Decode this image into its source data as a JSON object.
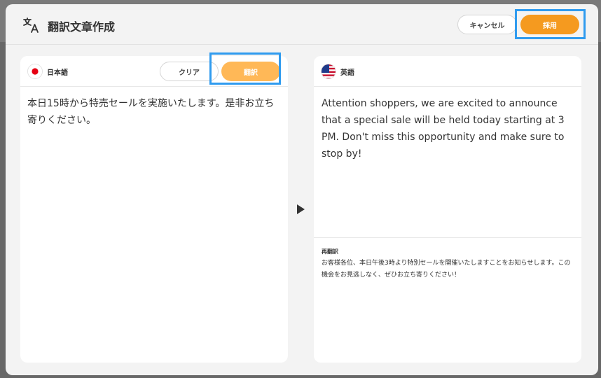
{
  "dialog": {
    "title": "翻訳文章作成",
    "cancel_label": "キャンセル",
    "adopt_label": "採用"
  },
  "source": {
    "language": "日本語",
    "clear_label": "クリア",
    "translate_label": "翻訳",
    "text": "本日15時から特売セールを実施いたします。是非お立ち寄りください。"
  },
  "target": {
    "language": "英語",
    "text": "Attention shoppers, we are excited to announce that a special sale will be held today starting at 3 PM. Don't miss this opportunity and make sure to stop by!",
    "retranslation_label": "再翻訳",
    "retranslation_text": "お客様各位、本日午後3時より特別セールを開催いたしますことをお知らせします。この機会をお見逃しなく、ぜひお立ち寄りください！"
  },
  "colors": {
    "accent": "#f59a1f",
    "accent_light": "#ffb857",
    "highlight": "#2f9bef"
  },
  "icons": {
    "title": "translate-icon",
    "source_flag": "japan-flag-icon",
    "target_flag": "us-flag-icon",
    "arrow": "play-arrow-icon"
  }
}
